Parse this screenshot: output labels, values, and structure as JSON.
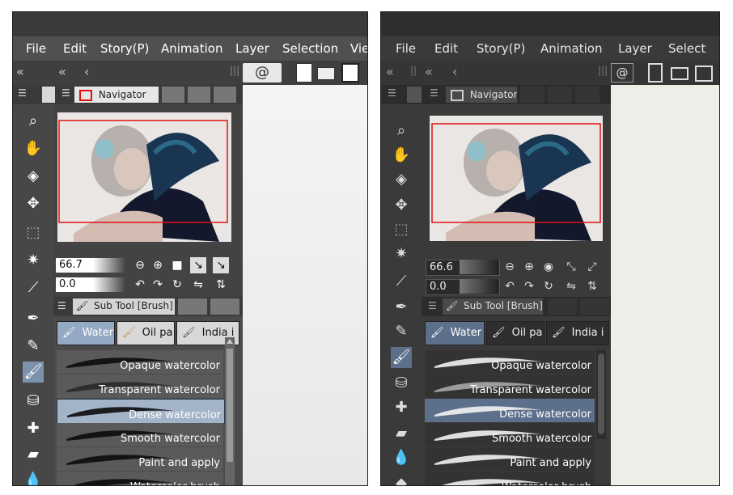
{
  "left_panel": {
    "menu": [
      "File",
      "Edit",
      "Story(P)",
      "Animation",
      "Layer",
      "Selection",
      "Vie"
    ],
    "nav_tab": "Navigator",
    "zoom_value": "66.7",
    "rotate_value": "0.0",
    "subtool_tab": "Sub Tool [Brush]",
    "chips": [
      "Water",
      "Oil pa",
      "India i"
    ],
    "brushes": [
      "Opaque watercolor",
      "Transparent watercolor",
      "Dense watercolor",
      "Smooth watercolor",
      "Paint and apply",
      "Watercolor brush"
    ],
    "selected_brush_index": 2
  },
  "right_panel": {
    "menu": [
      "File",
      "Edit",
      "Story(P)",
      "Animation",
      "Layer",
      "Select"
    ],
    "nav_tab": "Navigator",
    "zoom_value": "66.6",
    "rotate_value": "0.0",
    "subtool_tab": "Sub Tool [Brush]",
    "chips": [
      "Water",
      "Oil pa",
      "India i"
    ],
    "brushes": [
      "Opaque watercolor",
      "Transparent watercolor",
      "Dense watercolor",
      "Smooth watercolor",
      "Paint and apply",
      "Watercolor brush"
    ],
    "selected_brush_index": 2
  },
  "icons": {
    "collapse": "double-chevron-left-icon",
    "zoom": "magnifier-icon",
    "hand": "hand-icon",
    "rotate": "rotate-icon",
    "move": "move-icon",
    "select": "rectangle-select-icon",
    "wand": "magic-wand-icon",
    "eyedrop": "eyedropper-icon",
    "pen": "pen-icon",
    "pencil": "pencil-icon",
    "brush": "brush-icon",
    "spray": "airbrush-icon",
    "deco": "decoration-icon",
    "eraser": "eraser-icon",
    "blend": "blend-icon",
    "fill": "fill-icon"
  },
  "colors": {
    "light_bg": "#c9c9c9",
    "light_dark": "#3a3a3a",
    "dark_bg": "#3e3e3e",
    "dark_deep": "#2b2b2b",
    "selected": "#5c6e85",
    "nav_frame": "#e01010"
  }
}
